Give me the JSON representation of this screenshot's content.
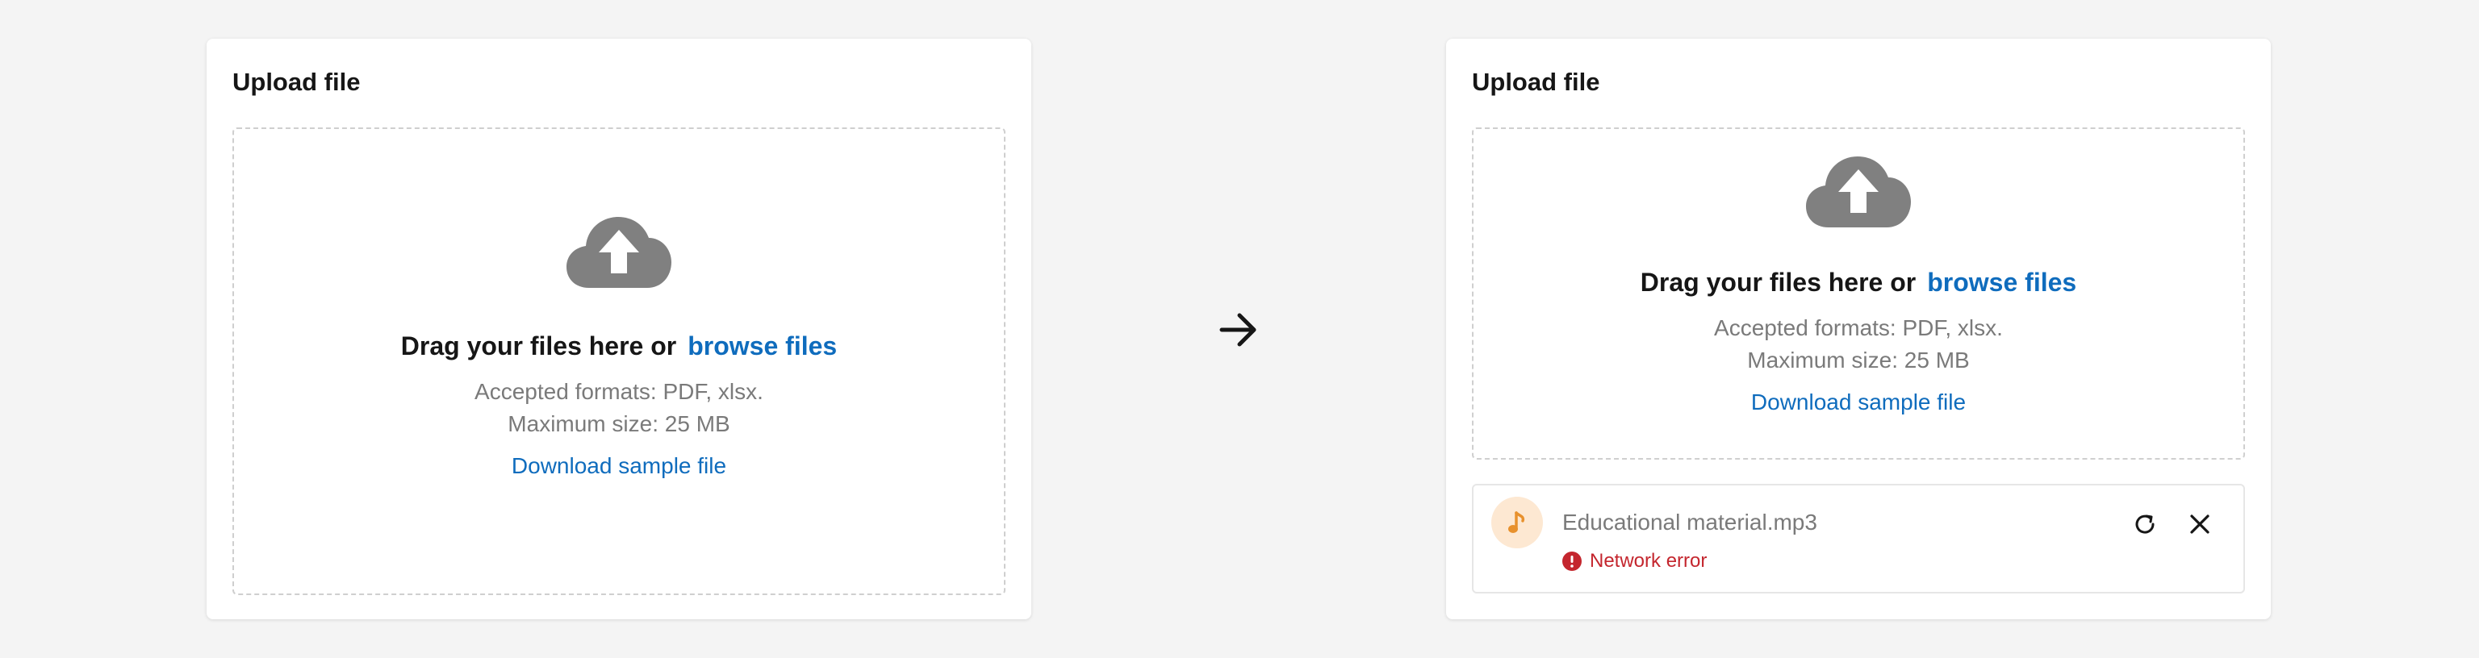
{
  "colors": {
    "background": "#f4f4f4",
    "card": "#ffffff",
    "link": "#0f6cbd",
    "icon_gray": "#808080",
    "error": "#c4262e",
    "file_avatar_bg": "#fde8d2",
    "file_avatar_fg": "#e8912d"
  },
  "before": {
    "title": "Upload file",
    "dropzone": {
      "icon": "cloud-upload-icon",
      "drag_text": "Drag your files here or",
      "browse_label": "browse files",
      "formats": "Accepted formats: PDF, xlsx.",
      "max_size": "Maximum size: 25 MB",
      "sample_link": "Download sample file"
    }
  },
  "transition_icon": "arrow-right-icon",
  "after": {
    "title": "Upload file",
    "dropzone": {
      "icon": "cloud-upload-icon",
      "drag_text": "Drag your files here or",
      "browse_label": "browse files",
      "formats": "Accepted formats: PDF, xlsx.",
      "max_size": "Maximum size: 25 MB",
      "sample_link": "Download sample file"
    },
    "file": {
      "icon": "music-note-icon",
      "name": "Educational material.mp3",
      "status_icon": "error-circle-icon",
      "status": "Network error",
      "retry_icon": "retry-icon",
      "remove_icon": "close-icon"
    }
  }
}
